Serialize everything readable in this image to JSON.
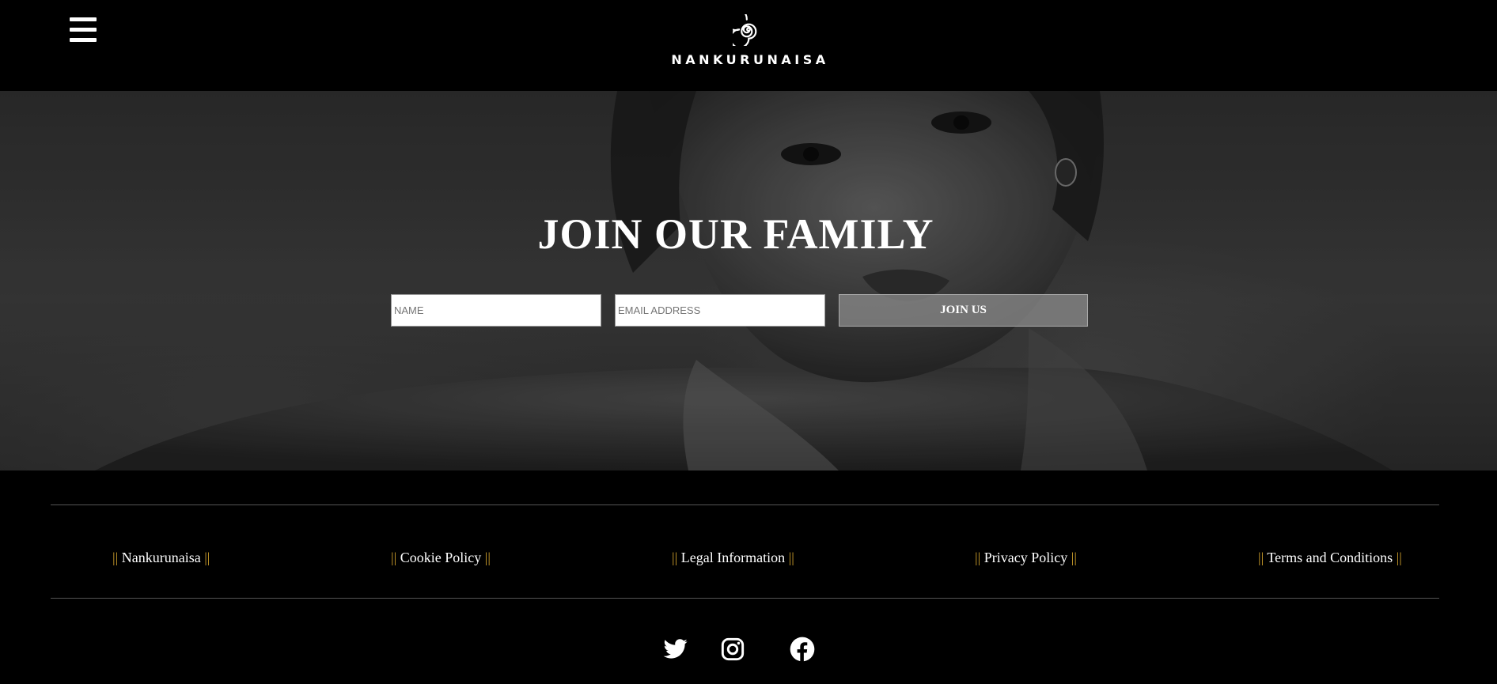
{
  "header": {
    "menu_icon": "hamburger-menu-icon",
    "logo_icon": "spiral-logo-icon",
    "brand_name": "NANKURUNAISA"
  },
  "hero": {
    "title": "JOIN OUR FAMILY",
    "name_placeholder": "NAME",
    "email_placeholder": "EMAIL ADDRESS",
    "submit_label": "JOIN US"
  },
  "footer": {
    "links": [
      {
        "bar_left": "||",
        "label": "Nankurunaisa",
        "bar_right": "||"
      },
      {
        "bar_left": "||",
        "label": "Cookie Policy",
        "bar_right": "||"
      },
      {
        "bar_left": "||",
        "label": "Legal Information",
        "bar_right": "||"
      },
      {
        "bar_left": "||",
        "label": "Privacy Policy",
        "bar_right": "||"
      },
      {
        "bar_left": "||",
        "label": "Terms and Conditions",
        "bar_right": "||"
      }
    ],
    "social": [
      {
        "icon": "twitter-icon"
      },
      {
        "icon": "instagram-icon"
      },
      {
        "icon": "facebook-icon"
      }
    ]
  },
  "colors": {
    "background": "#000000",
    "text": "#ffffff",
    "link_bars": "#c89a2a",
    "button_bg": "#8c8c8c"
  }
}
